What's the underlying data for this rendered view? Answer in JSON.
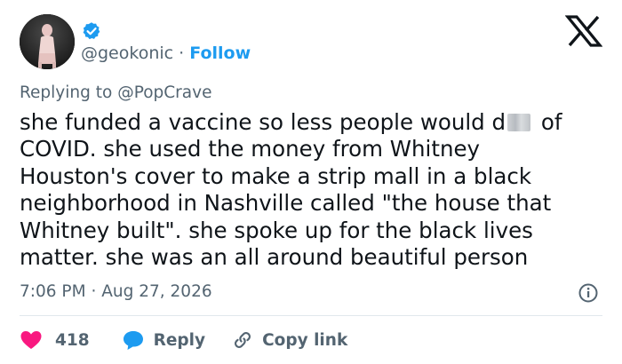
{
  "author": {
    "handle": "@geokonic",
    "separator": "·",
    "follow_label": "Follow"
  },
  "reply_context": {
    "prefix": "Replying to",
    "target": "@PopCrave"
  },
  "tweet": {
    "lines": [
      {
        "before": "she funded a vaccine so less people would d",
        "after": " of"
      },
      {
        "text": "COVID. she used the money from Whitney"
      },
      {
        "text": "Houston's cover to make a strip mall in a black"
      },
      {
        "text": "neighborhood in Nashville called \"the house that"
      },
      {
        "text": "Whitney built\". she spoke up for the black lives"
      },
      {
        "text": "matter. she was an all around beautiful person"
      }
    ]
  },
  "meta": {
    "time": "7:06 PM",
    "separator": "·",
    "date": "Aug 27, 2026"
  },
  "actions": {
    "like_count": "418",
    "reply_label": "Reply",
    "copy_label": "Copy link"
  },
  "colors": {
    "accent": "#1d9bf0",
    "like": "#f91880",
    "muted": "#536471",
    "text": "#0f1419"
  }
}
